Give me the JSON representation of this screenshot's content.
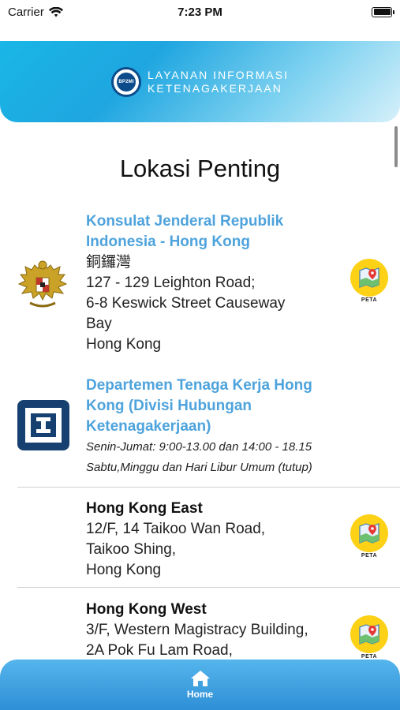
{
  "status_bar": {
    "carrier": "Carrier",
    "time": "7:23 PM"
  },
  "header": {
    "logo_text": "BP2MI",
    "title_line1": "Layanan Informasi",
    "title_line2": "Ketenagakerjaan"
  },
  "page": {
    "title": "Lokasi Penting"
  },
  "entries": [
    {
      "logo": "garuda-emblem",
      "title_lines": [
        "Konsulat Jenderal Republik",
        "Indonesia - Hong Kong"
      ],
      "address_lines": [
        "銅鑼灣",
        "127 - 129 Leighton Road;",
        "6-8 Keswick Street Causeway",
        "Bay",
        "Hong Kong"
      ],
      "map_label": "PETA"
    },
    {
      "logo": "labour-department-logo",
      "title_lines": [
        "Departemen Tenaga Kerja Hong",
        "Kong (Divisi Hubungan",
        "Ketenagakerjaan)"
      ],
      "hours_lines": [
        "Senin-Jumat: 9:00-13.00 dan 14:00 - 18.15",
        "Sabtu,Minggu dan Hari Libur Umum (tutup)"
      ]
    },
    {
      "name": "Hong Kong East",
      "address_lines": [
        "12/F, 14 Taikoo Wan Road,",
        "Taikoo Shing,",
        "Hong Kong"
      ],
      "map_label": "PETA"
    },
    {
      "name": "Hong Kong West",
      "address_lines": [
        "3/F, Western Magistracy Building,",
        "2A Pok Fu Lam Road,"
      ],
      "map_label": "PETA"
    }
  ],
  "tab_bar": {
    "home_label": "Home"
  },
  "colors": {
    "header_gradient_start": "#19b6e6",
    "entry_title": "#4ea3dc",
    "map_button": "#fcd116",
    "tab_bar": "#2e8fd6"
  }
}
